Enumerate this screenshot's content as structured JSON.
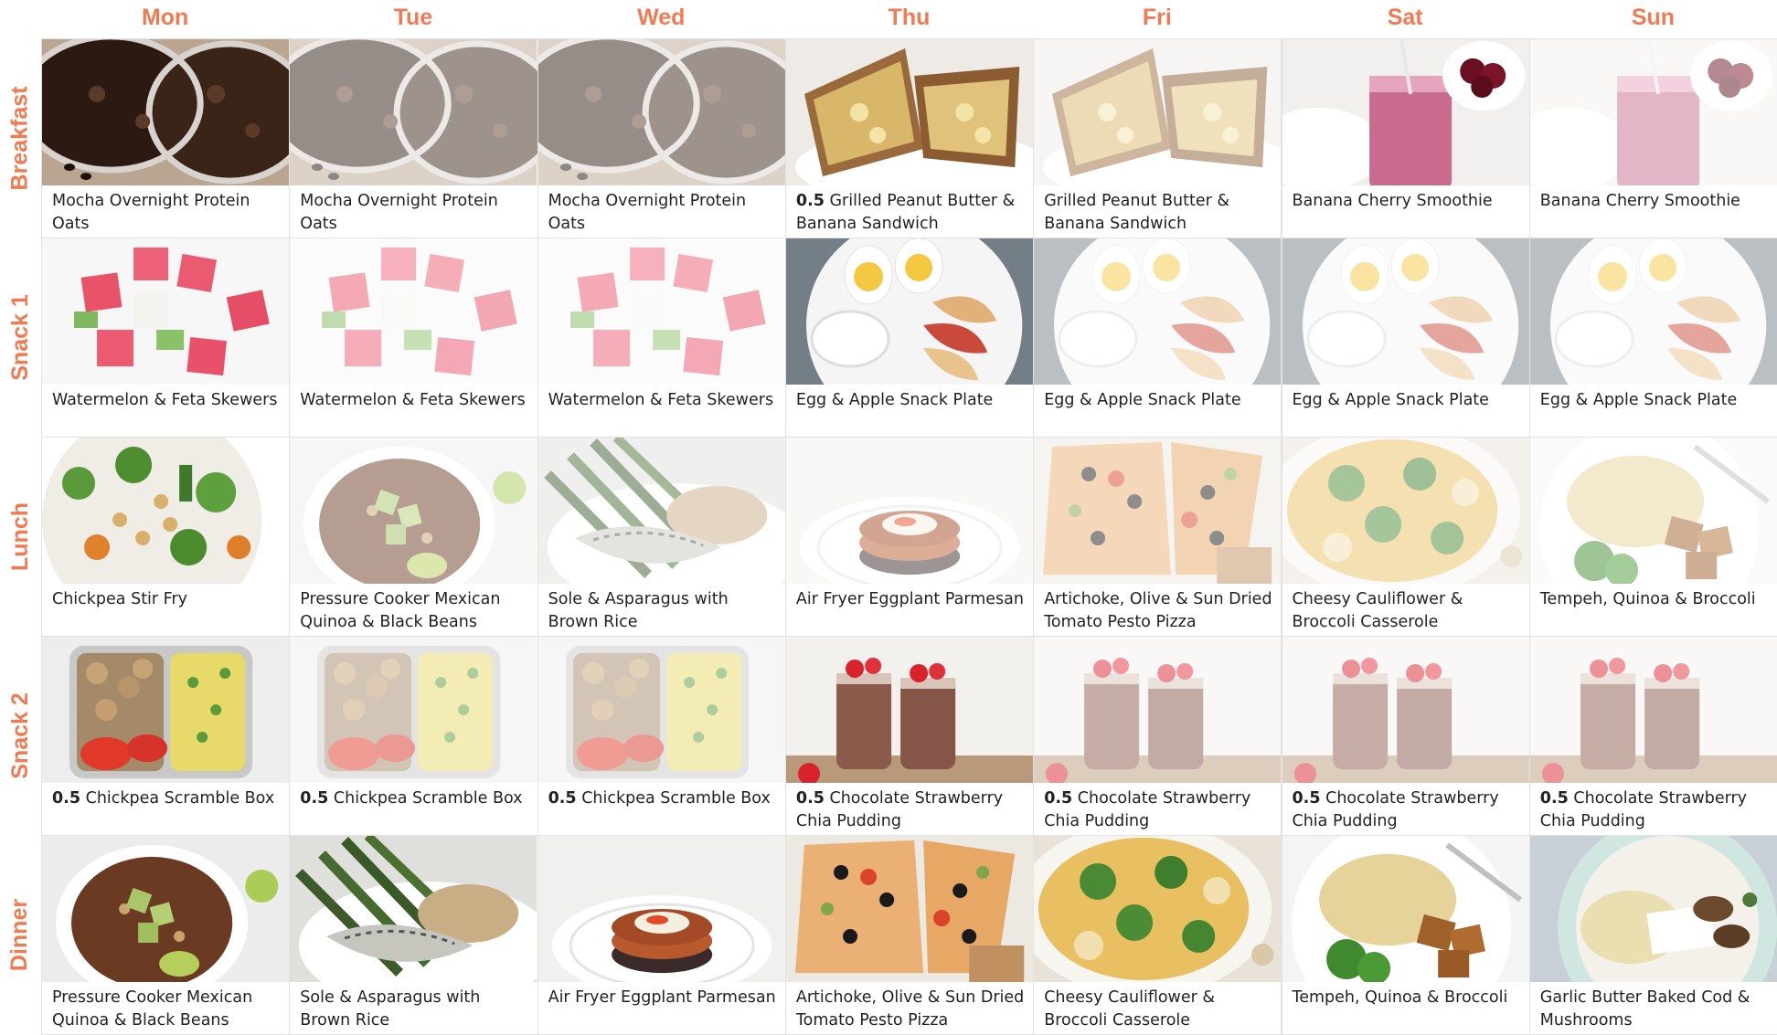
{
  "days": [
    "Mon",
    "Tue",
    "Wed",
    "Thu",
    "Fri",
    "Sat",
    "Sun"
  ],
  "meals": [
    {
      "label": "Breakfast",
      "cells": [
        {
          "qty": "",
          "name": "Mocha Overnight Protein Oats",
          "photo": "oats",
          "faded": false
        },
        {
          "qty": "",
          "name": "Mocha Overnight Protein Oats",
          "photo": "oats",
          "faded": true
        },
        {
          "qty": "",
          "name": "Mocha Overnight Protein Oats",
          "photo": "oats",
          "faded": true
        },
        {
          "qty": "0.5",
          "name": "Grilled Peanut Butter & Banana Sandwich",
          "photo": "sandwich",
          "faded": false
        },
        {
          "qty": "",
          "name": "Grilled Peanut Butter & Banana Sandwich",
          "photo": "sandwich",
          "faded": true
        },
        {
          "qty": "",
          "name": "Banana Cherry Smoothie",
          "photo": "smoothie",
          "faded": false
        },
        {
          "qty": "",
          "name": "Banana Cherry Smoothie",
          "photo": "smoothie",
          "faded": true
        }
      ]
    },
    {
      "label": "Snack 1",
      "cells": [
        {
          "qty": "",
          "name": "Watermelon & Feta Skewers",
          "photo": "watermelon",
          "faded": false
        },
        {
          "qty": "",
          "name": "Watermelon & Feta Skewers",
          "photo": "watermelon",
          "faded": true
        },
        {
          "qty": "",
          "name": "Watermelon & Feta Skewers",
          "photo": "watermelon",
          "faded": true
        },
        {
          "qty": "",
          "name": "Egg & Apple Snack Plate",
          "photo": "eggplate",
          "faded": false
        },
        {
          "qty": "",
          "name": "Egg & Apple Snack Plate",
          "photo": "eggplate",
          "faded": true
        },
        {
          "qty": "",
          "name": "Egg & Apple Snack Plate",
          "photo": "eggplate",
          "faded": true
        },
        {
          "qty": "",
          "name": "Egg & Apple Snack Plate",
          "photo": "eggplate",
          "faded": true
        }
      ]
    },
    {
      "label": "Lunch",
      "cells": [
        {
          "qty": "",
          "name": "Chickpea Stir Fry",
          "photo": "stirfry",
          "faded": false
        },
        {
          "qty": "",
          "name": "Pressure Cooker Mexican Quinoa & Black Beans",
          "photo": "quinoabowl",
          "faded": true
        },
        {
          "qty": "",
          "name": "Sole & Asparagus with Brown Rice",
          "photo": "sole",
          "faded": true
        },
        {
          "qty": "",
          "name": "Air Fryer Eggplant Parmesan",
          "photo": "eggplantparm",
          "faded": true
        },
        {
          "qty": "",
          "name": "Artichoke, Olive & Sun Dried Tomato Pesto Pizza",
          "photo": "pizza",
          "faded": true
        },
        {
          "qty": "",
          "name": "Cheesy Cauliflower & Broccoli Casserole",
          "photo": "casserole",
          "faded": true
        },
        {
          "qty": "",
          "name": "Tempeh, Quinoa & Broccoli",
          "photo": "tempeh",
          "faded": true
        }
      ]
    },
    {
      "label": "Snack 2",
      "cells": [
        {
          "qty": "0.5",
          "name": "Chickpea Scramble Box",
          "photo": "scramblebox",
          "faded": false
        },
        {
          "qty": "0.5",
          "name": "Chickpea Scramble Box",
          "photo": "scramblebox",
          "faded": true
        },
        {
          "qty": "0.5",
          "name": "Chickpea Scramble Box",
          "photo": "scramblebox",
          "faded": true
        },
        {
          "qty": "0.5",
          "name": "Chocolate Strawberry Chia Pudding",
          "photo": "chia",
          "faded": false
        },
        {
          "qty": "0.5",
          "name": "Chocolate Strawberry Chia Pudding",
          "photo": "chia",
          "faded": true
        },
        {
          "qty": "0.5",
          "name": "Chocolate Strawberry Chia Pudding",
          "photo": "chia",
          "faded": true
        },
        {
          "qty": "0.5",
          "name": "Chocolate Strawberry Chia Pudding",
          "photo": "chia",
          "faded": true
        }
      ]
    },
    {
      "label": "Dinner",
      "cells": [
        {
          "qty": "",
          "name": "Pressure Cooker Mexican Quinoa & Black Beans",
          "photo": "quinoabowl",
          "faded": false
        },
        {
          "qty": "",
          "name": "Sole & Asparagus with Brown Rice",
          "photo": "sole",
          "faded": false
        },
        {
          "qty": "",
          "name": "Air Fryer Eggplant Parmesan",
          "photo": "eggplantparm",
          "faded": false
        },
        {
          "qty": "",
          "name": "Artichoke, Olive & Sun Dried Tomato Pesto Pizza",
          "photo": "pizza",
          "faded": false
        },
        {
          "qty": "",
          "name": "Cheesy Cauliflower & Broccoli Casserole",
          "photo": "casserole",
          "faded": false
        },
        {
          "qty": "",
          "name": "Tempeh, Quinoa & Broccoli",
          "photo": "tempeh",
          "faded": false
        },
        {
          "qty": "",
          "name": "Garlic Butter Baked Cod & Mushrooms",
          "photo": "cod",
          "faded": false
        }
      ]
    }
  ],
  "colors": {
    "accent": "#f07a52",
    "caption_text": "#222222",
    "grid_border": "#e2e2e2"
  }
}
